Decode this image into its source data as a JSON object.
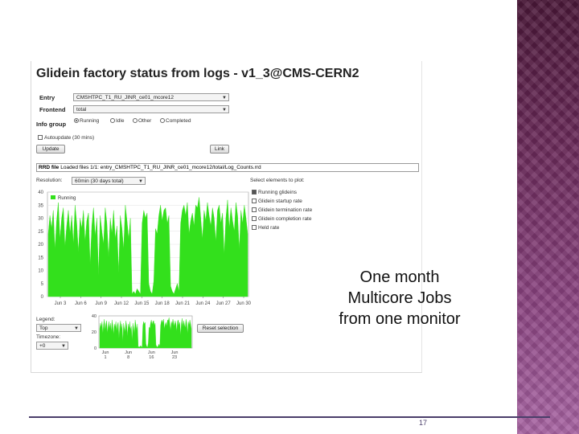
{
  "page": {
    "caption_lines": [
      "One month",
      "Multicore Jobs",
      "from one monitor"
    ],
    "page_number": "17"
  },
  "app": {
    "title": "Glidein factory status from logs - v1_3@CMS-CERN2",
    "entry_label": "Entry",
    "entry_value": "CMSHTPC_T1_RU_JINR_ce01_mcore12",
    "frontend_label": "Frontend",
    "frontend_value": "total",
    "info_group_label": "Info group",
    "info_group_options": [
      "Running",
      "Idle",
      "Other",
      "Completed"
    ],
    "info_group_selected": "Running",
    "autoupdate_label": "Autoupdate (30 mins)",
    "update_button": "Update",
    "link_button": "Link",
    "rrd_label": "RRD file",
    "rrd_value": "Loaded files 1/1: entry_CMSHTPC_T1_RU_JINR_ce01_mcore12/total/Log_Counts.rrd",
    "resolution_label": "Resolution:",
    "resolution_value": "60min (30 days total)",
    "select_elements_label": "Select elements to plot:",
    "plot_elements": [
      {
        "label": "Running glideins",
        "checked": true
      },
      {
        "label": "Glidein startup rate",
        "checked": false
      },
      {
        "label": "Glidein termination rate",
        "checked": false
      },
      {
        "label": "Glidein completion rate",
        "checked": false
      },
      {
        "label": "Held rate",
        "checked": false
      }
    ],
    "legend_label": "Legend:",
    "legend_value": "Top",
    "timezone_label": "Timezone:",
    "timezone_value": "+0",
    "reset_button": "Reset selection",
    "series_color": "#33e01c"
  },
  "chart_data": [
    {
      "type": "area",
      "series": [
        {
          "name": "Running",
          "values": [
            24,
            31,
            26,
            33,
            18,
            29,
            36,
            22,
            30,
            34,
            19,
            27,
            33,
            24,
            31,
            20,
            35,
            28,
            17,
            30,
            26,
            33,
            21,
            29,
            32,
            12,
            27,
            34,
            23,
            30,
            8,
            31,
            25,
            20,
            34,
            28,
            15,
            30,
            24,
            33,
            22,
            27,
            9,
            31,
            26,
            18,
            35,
            29,
            22,
            30,
            1,
            2,
            1,
            3,
            2,
            1,
            28,
            33,
            30,
            32,
            5,
            2,
            1,
            6,
            26,
            24,
            31,
            35,
            29,
            33,
            34,
            28,
            31,
            4,
            2,
            1,
            3,
            5,
            2,
            28,
            33,
            35,
            31,
            36,
            24,
            29,
            32,
            27,
            35,
            34,
            38,
            30,
            22,
            33,
            29,
            36,
            31,
            27,
            34,
            30,
            21,
            33,
            35,
            28,
            32,
            16,
            30,
            37,
            26,
            34,
            29,
            25,
            36,
            31,
            18,
            33,
            28,
            35,
            30,
            24
          ]
        }
      ],
      "x_ticks": [
        "Jun 3",
        "Jun 6",
        "Jun 9",
        "Jun 12",
        "Jun 15",
        "Jun 18",
        "Jun 21",
        "Jun 24",
        "Jun 27",
        "Jun 30"
      ],
      "y_ticks": [
        "0",
        "5",
        "10",
        "15",
        "20",
        "25",
        "30",
        "35",
        "40"
      ],
      "ylim": [
        0,
        40
      ],
      "grid": true,
      "legend": "top-left"
    },
    {
      "type": "area",
      "series": [
        {
          "name": "Running",
          "values": [
            24,
            31,
            26,
            33,
            18,
            29,
            36,
            22,
            30,
            34,
            19,
            27,
            33,
            24,
            31,
            20,
            35,
            28,
            17,
            30,
            26,
            33,
            21,
            29,
            32,
            12,
            27,
            34,
            23,
            30,
            8,
            31,
            25,
            20,
            34,
            28,
            15,
            30,
            24,
            33,
            22,
            27,
            9,
            31,
            26,
            18,
            35,
            29,
            22,
            30,
            1,
            2,
            1,
            3,
            2,
            1,
            28,
            33,
            30,
            32,
            5,
            2,
            1,
            6,
            26,
            24,
            31,
            35,
            29,
            33,
            34,
            28,
            31,
            4,
            2,
            1,
            3,
            5,
            2,
            28,
            33,
            35,
            31,
            36,
            24,
            29,
            32,
            27,
            35,
            34,
            38,
            30,
            22,
            33,
            29,
            36,
            31,
            27,
            34,
            30,
            21,
            33,
            35,
            28,
            32,
            16,
            30,
            37,
            26,
            34,
            29,
            25,
            36,
            31,
            18,
            33,
            28,
            35,
            30,
            24
          ]
        }
      ],
      "x_ticks": [
        "Jun\n1",
        "Jun\n8",
        "Jun\n16",
        "Jun\n23"
      ],
      "y_ticks": [
        "0",
        "20",
        "40"
      ],
      "ylim": [
        0,
        40
      ],
      "legend": "none"
    }
  ]
}
